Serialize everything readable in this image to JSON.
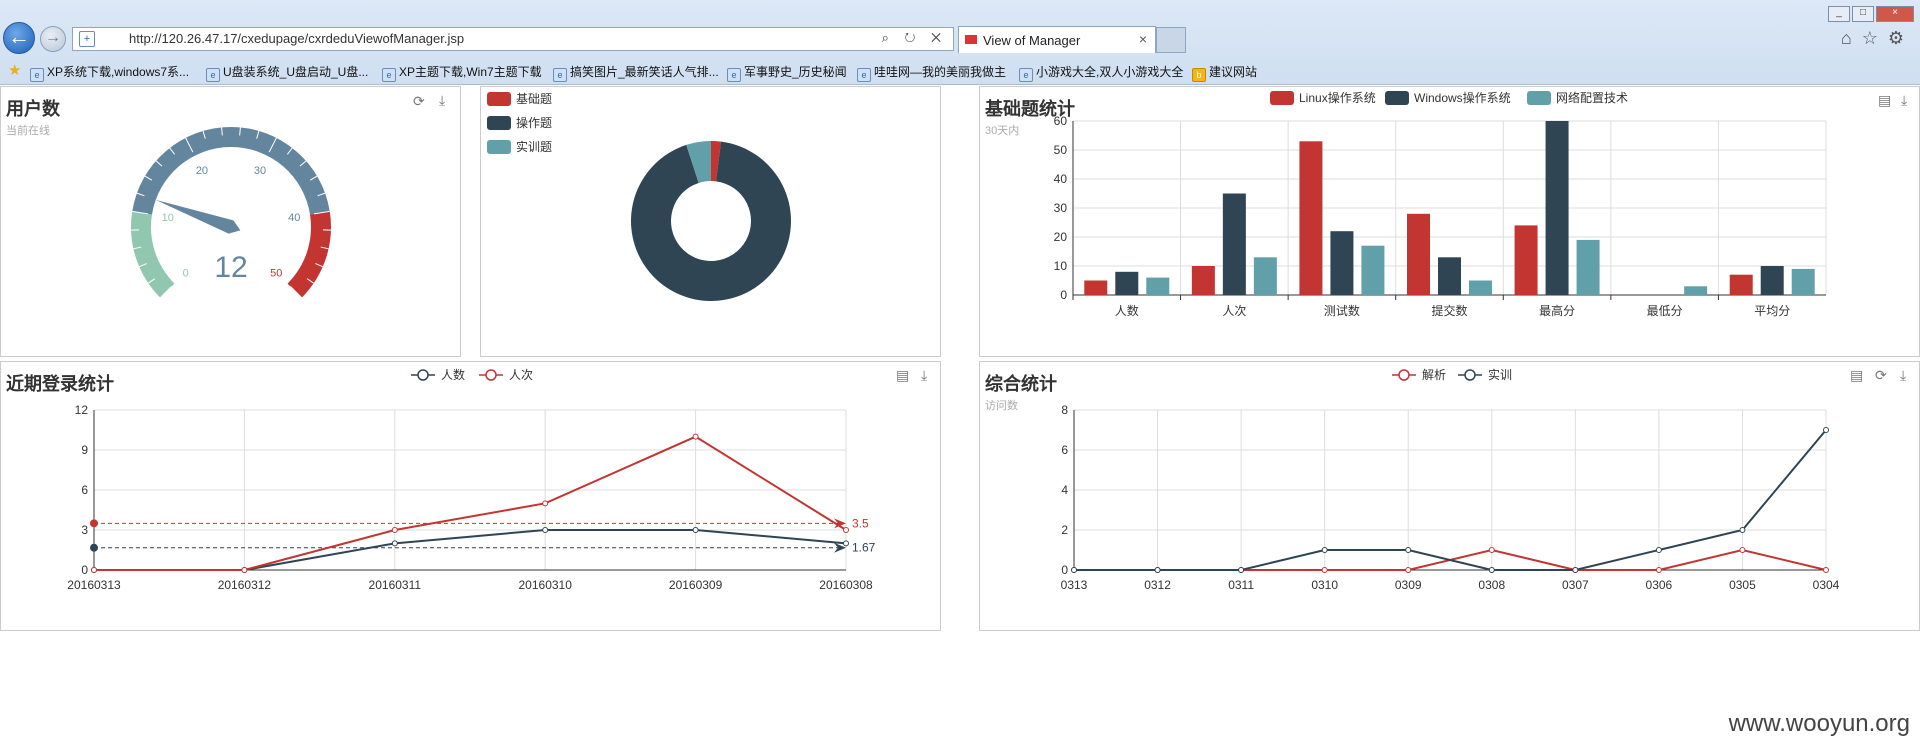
{
  "browser": {
    "url": "http://120.26.47.17/cxedupage/cxrdeduViewofManager.jsp",
    "tab_title": "View of Manager",
    "favorites": [
      "XP系统下载,windows7系...",
      "U盘装系统_U盘启动_U盘...",
      "XP主题下载,Win7主题下载",
      "搞笑图片_最新笑话人气排...",
      "军事野史_历史秘闻",
      "哇哇网—我的美丽我做主",
      "小游戏大全,双人小游戏大全",
      "建议网站"
    ]
  },
  "gauge_panel": {
    "title": "用户数",
    "subtitle": "当前在线",
    "value": "12",
    "ticks": [
      "0",
      "10",
      "20",
      "30",
      "40",
      "50"
    ],
    "colors": {
      "low": "#91c7ae",
      "mid": "#63869e",
      "high": "#c23531"
    }
  },
  "pie_panel": {
    "legend": [
      "基础题",
      "操作题",
      "实训题"
    ],
    "chart_data": {
      "type": "pie",
      "categories": [
        "基础题",
        "操作题",
        "实训题"
      ],
      "values": [
        2,
        93,
        5
      ],
      "colors": [
        "#c23531",
        "#2f4554",
        "#61a0a8"
      ]
    }
  },
  "bar_panel": {
    "title": "基础题统计",
    "subtitle": "30天内",
    "chart_data": {
      "type": "bar",
      "categories": [
        "人数",
        "人次",
        "测试数",
        "提交数",
        "最高分",
        "最低分",
        "平均分"
      ],
      "series": [
        {
          "name": "Linux操作系统",
          "values": [
            5,
            10,
            53,
            28,
            24,
            0,
            7
          ],
          "color": "#c23531"
        },
        {
          "name": "Windows操作系统",
          "values": [
            8,
            35,
            22,
            13,
            60,
            0,
            10
          ],
          "color": "#2f4554"
        },
        {
          "name": "网络配置技术",
          "values": [
            6,
            13,
            17,
            5,
            19,
            3,
            9
          ],
          "color": "#61a0a8"
        }
      ],
      "ylim": [
        0,
        60
      ],
      "yticks": [
        "0",
        "10",
        "20",
        "30",
        "40",
        "50",
        "60"
      ],
      "legend_position": "top"
    }
  },
  "login_panel": {
    "title": "近期登录统计",
    "chart_data": {
      "type": "line",
      "categories": [
        "20160313",
        "20160312",
        "20160311",
        "20160310",
        "20160309",
        "20160308"
      ],
      "series": [
        {
          "name": "人数",
          "values": [
            0,
            0,
            2,
            3,
            3,
            2
          ],
          "color": "#2f4554",
          "avg": "1.67",
          "avg_value": 1.67
        },
        {
          "name": "人次",
          "values": [
            0,
            0,
            3,
            5,
            10,
            3
          ],
          "color": "#c23531",
          "avg": "3.5",
          "avg_value": 3.5
        }
      ],
      "ylim": [
        0,
        12
      ],
      "yticks": [
        "0",
        "3",
        "6",
        "9",
        "12"
      ],
      "legend_position": "top"
    }
  },
  "combo_panel": {
    "title": "综合统计",
    "subtitle": "访问数",
    "chart_data": {
      "type": "line",
      "categories": [
        "0313",
        "0312",
        "0311",
        "0310",
        "0309",
        "0308",
        "0307",
        "0306",
        "0305",
        "0304"
      ],
      "series": [
        {
          "name": "解析",
          "values": [
            0,
            0,
            0,
            0,
            0,
            1,
            0,
            0,
            1,
            0
          ],
          "color": "#c23531"
        },
        {
          "name": "实训",
          "values": [
            0,
            0,
            0,
            1,
            1,
            0,
            0,
            1,
            2,
            7
          ],
          "color": "#2f4554"
        }
      ],
      "ylim": [
        0,
        8
      ],
      "yticks": [
        "0",
        "2",
        "4",
        "6",
        "8"
      ],
      "legend_position": "top"
    }
  },
  "icons": {
    "refresh": "refresh-icon",
    "download": "download-icon",
    "data_view": "data-view-icon"
  },
  "watermark": "www.wooyun.org"
}
